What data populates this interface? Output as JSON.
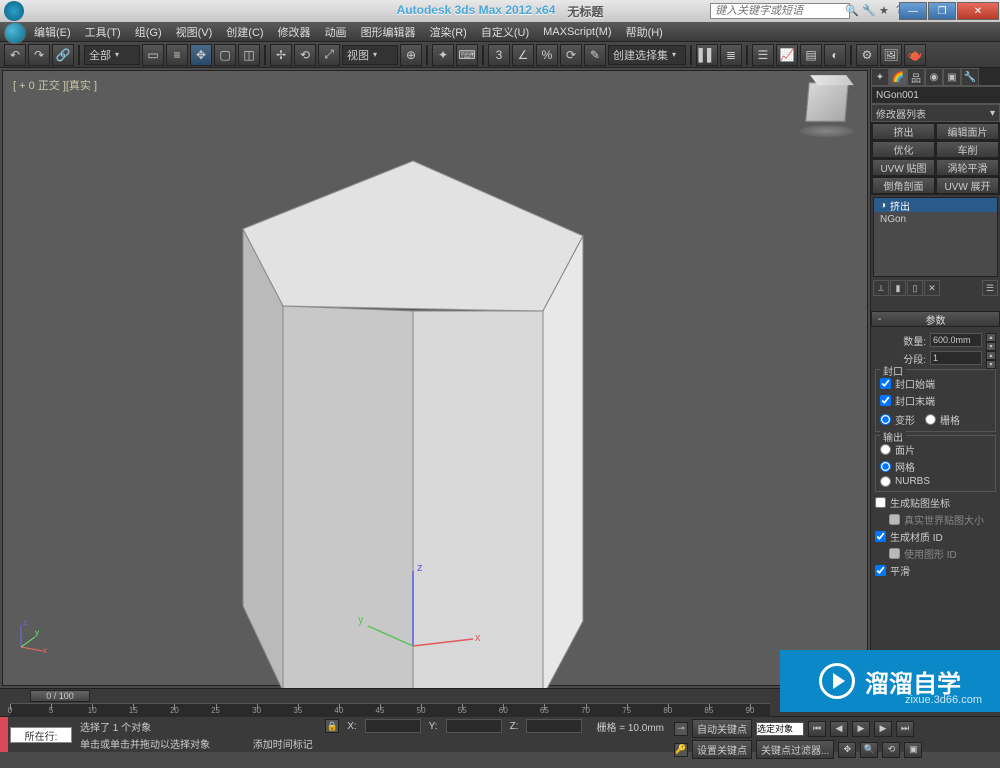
{
  "title": {
    "app": "Autodesk 3ds Max  2012 x64",
    "doc": "无标题"
  },
  "search_placeholder": "键入关键字或短语",
  "menu": [
    {
      "label": "编辑(E)"
    },
    {
      "label": "工具(T)"
    },
    {
      "label": "组(G)"
    },
    {
      "label": "视图(V)"
    },
    {
      "label": "创建(C)"
    },
    {
      "label": "修改器"
    },
    {
      "label": "动画"
    },
    {
      "label": "图形编辑器"
    },
    {
      "label": "渲染(R)"
    },
    {
      "label": "自定义(U)"
    },
    {
      "label": "MAXScript(M)"
    },
    {
      "label": "帮助(H)"
    }
  ],
  "toolbar": {
    "filter_all": "全部",
    "view_label": "视图",
    "selection_set": "创建选择集"
  },
  "viewport": {
    "label": "[ + 0 正交 ][真实 ]"
  },
  "panel": {
    "object_name": "NGon001",
    "modifier_list": "修改器列表",
    "mod_buttons": [
      "挤出",
      "编辑面片",
      "优化",
      "车削",
      "UVW 贴图",
      "涡轮平滑",
      "倒角剖面",
      "UVW 展开"
    ],
    "stack": [
      {
        "label": "挤出",
        "selected": true,
        "icon": "◑"
      },
      {
        "label": "NGon",
        "selected": false,
        "icon": ""
      }
    ],
    "rollout_title": "参数",
    "params": {
      "amount_label": "数量:",
      "amount_value": "600.0mm",
      "segments_label": "分段:",
      "segments_value": "1",
      "cap_group": "封口",
      "cap_start": "封口始端",
      "cap_end": "封口末端",
      "cap_morph": "变形",
      "cap_grid": "栅格",
      "output_group": "输出",
      "out_patch": "面片",
      "out_mesh": "网格",
      "out_nurbs": "NURBS",
      "gen_mapping": "生成贴图坐标",
      "real_world": "真实世界贴图大小",
      "gen_matids": "生成材质 ID",
      "use_shape_ids": "使用图形 ID",
      "smooth": "平滑"
    }
  },
  "timeline": {
    "slider": "0 / 100",
    "ticks": [
      0,
      5,
      10,
      15,
      20,
      25,
      30,
      35,
      40,
      45,
      50,
      55,
      60,
      65,
      70,
      75,
      80,
      85,
      90
    ]
  },
  "status": {
    "location_label": "所在行:",
    "selection": "选择了 1 个对象",
    "prompt": "单击或单击并拖动以选择对象",
    "add_time_tag": "添加时间标记",
    "grid": "栅格 = 10.0mm",
    "x": "X:",
    "y": "Y:",
    "z": "Z:",
    "autokey": "自动关键点",
    "selected_anim": "选定对象",
    "setkey": "设置关键点",
    "keyfilter": "关键点过滤器..."
  },
  "watermark": {
    "text": "溜溜自学",
    "url": "zixue.3d66.com"
  }
}
